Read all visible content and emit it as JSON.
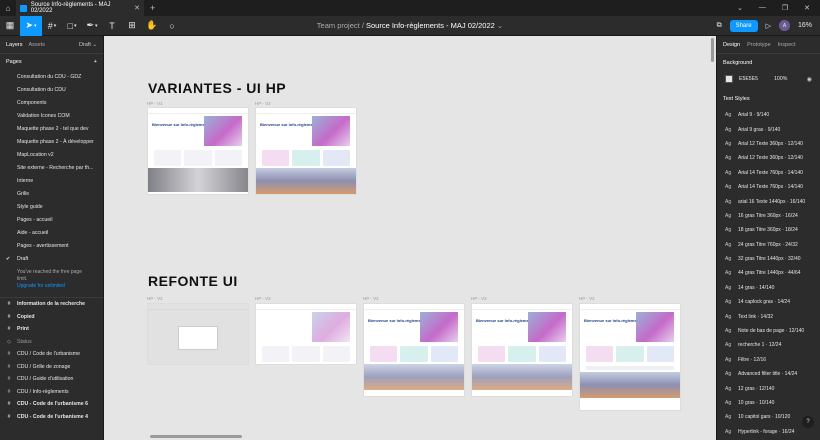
{
  "titlebar": {
    "tab_title": "Source Info-règlements - MAJ 02/2022"
  },
  "breadcrumb": {
    "team": "Team project",
    "file": "Source Info-règlements - MAJ 02/2022"
  },
  "toolbar": {
    "share": "Share",
    "avatar": "A",
    "zoom": "16%"
  },
  "left_panel": {
    "tab_layers": "Layers",
    "tab_assets": "Assets",
    "branch": "Draft",
    "pages_title": "Pages",
    "pages": [
      "Consultation du CDU - GDZ",
      "Consultation du CDU",
      "Components",
      "Validation Icones COM",
      "Maquette phase 2 - tel que dev",
      "Maquette phase 2 - À développer",
      "MapLocation v2",
      "Site externe - Recherche par th...",
      "Interne",
      "Grille",
      "Style guide",
      "Pages - accueil",
      "Aide - accueil",
      "Pages - avertissement"
    ],
    "selected_page": "Draft",
    "limit_text": "You've reached the free page limit.",
    "upgrade_text": "Upgrade for unlimited",
    "layers": [
      {
        "label": "Information de la recherche",
        "icon": "#",
        "style": "bold"
      },
      {
        "label": "Copied",
        "icon": "#",
        "style": "bold"
      },
      {
        "label": "Print",
        "icon": "#",
        "style": "bold"
      },
      {
        "label": "Status",
        "icon": "◇",
        "style": "muted"
      },
      {
        "label": "CDU / Code de l'urbanisme",
        "icon": "#",
        "style": ""
      },
      {
        "label": "CDU / Grille de zonage",
        "icon": "#",
        "style": ""
      },
      {
        "label": "CDU / Guide d'utilisation",
        "icon": "#",
        "style": ""
      },
      {
        "label": "CDU / Info-règlements",
        "icon": "#",
        "style": ""
      },
      {
        "label": "CDU - Code de l'urbanisme 6",
        "icon": "#",
        "style": "bold"
      },
      {
        "label": "CDU - Code de l'urbanisme 4",
        "icon": "#",
        "style": "bold"
      }
    ]
  },
  "canvas": {
    "section1_title": "VARIANTES - UI HP",
    "section2_title": "REFONTE UI",
    "frame_labels_row1": [
      "HP - V1",
      "HP - V2"
    ],
    "frame_labels_row2": [
      "HP - V2",
      "HP - V2",
      "HP - V2",
      "HP - V2",
      "HP - V2"
    ],
    "hero_text": "Bienvenue sur Info-règlements"
  },
  "right_panel": {
    "tab_design": "Design",
    "tab_prototype": "Prototype",
    "tab_inspect": "Inspect",
    "background_title": "Background",
    "bg_hex": "E5E5E5",
    "bg_opacity": "100%",
    "text_styles_title": "Text Styles",
    "text_styles": [
      "Arial 9 · 9/140",
      "Arial 9 gras · 9/140",
      "Arial 12 Texte 360px · 12/140",
      "Arial 12 Texte 360px · 12/140",
      "Arial 14 Texte 760px · 14/140",
      "Arial 14 Texte 760px · 14/140",
      "arial 16 Texte 1440px · 16/140",
      "16 gras Titre 360px · 16/24",
      "18 gras Titre 360px · 18/24",
      "24 gras Titre 760px · 24/32",
      "32 gras Titre 1440px · 32/40",
      "44 gras Titre 1440px · 44/64",
      "14 gras · 14/140",
      "14 caplock gras · 14/24",
      "Text link · 14/32",
      "Note de bas de page · 12/140",
      "recherche 1 · 12/24",
      "Filtre · 12/16",
      "Advanced filter title · 14/24",
      "12 gras · 12/140",
      "10 gras · 10/140",
      "10 capitol gars · 10/120",
      "Hyperlink - forage · 16/24"
    ]
  },
  "colors": {
    "accent": "#0d99ff",
    "panel": "#2c2c2c",
    "canvas": "#e5e5e5"
  }
}
